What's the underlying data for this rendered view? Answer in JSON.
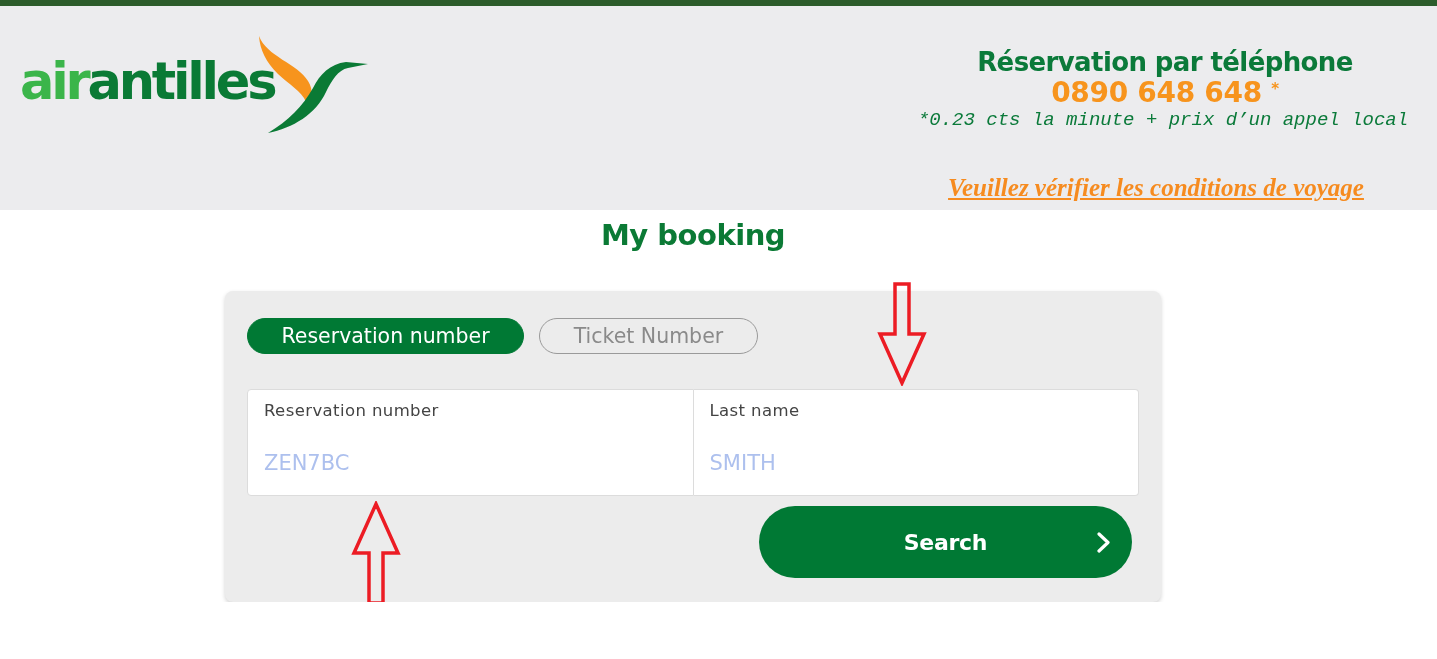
{
  "header": {
    "logo": {
      "prefix": "air",
      "name": "antilles"
    },
    "phone": {
      "title": "Réservation par téléphone",
      "number": "0890 648 648 $^{*}$",
      "note": "*0.23 cts la minute + prix d’un appel local"
    },
    "link": "Veuillez vérifier les conditions de voyage"
  },
  "title": "My booking",
  "tabs": [
    {
      "label": "Reservation number",
      "selected": true
    },
    {
      "label": "Ticket Number",
      "selected": false
    }
  ],
  "fields": [
    {
      "label": "Reservation number",
      "placeholder": "ZEN7BC",
      "annotation": {
        "kind": "up_arrow"
      }
    },
    {
      "label": "Last name",
      "placeholder": "SMITH",
      "annotation": {
        "kind": "down_arrow"
      }
    }
  ],
  "search_button": {
    "label": "Search"
  }
}
